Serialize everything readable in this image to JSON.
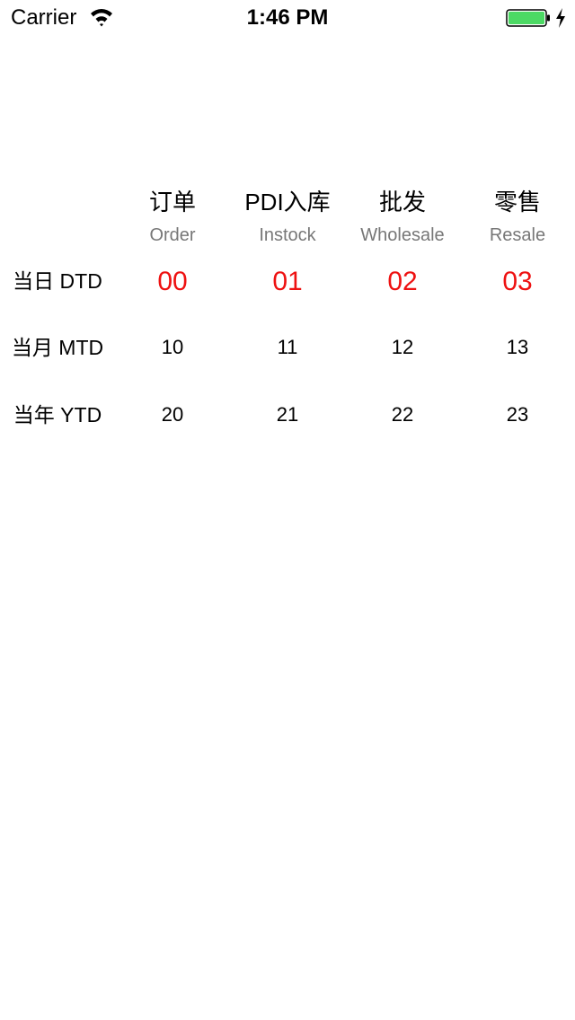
{
  "status_bar": {
    "carrier": "Carrier",
    "time": "1:46 PM",
    "battery_color": "#4cd964"
  },
  "table": {
    "columns": [
      {
        "cn": "订单",
        "en": "Order"
      },
      {
        "cn": "PDI入库",
        "en": "Instock"
      },
      {
        "cn": "批发",
        "en": "Wholesale"
      },
      {
        "cn": "零售",
        "en": "Resale"
      }
    ],
    "rows": [
      {
        "label": "当日 DTD",
        "values": [
          "00",
          "01",
          "02",
          "03"
        ]
      },
      {
        "label": "当月 MTD",
        "values": [
          "10",
          "11",
          "12",
          "13"
        ]
      },
      {
        "label": "当年 YTD",
        "values": [
          "20",
          "21",
          "22",
          "23"
        ]
      }
    ],
    "highlight_color": "#ee1111"
  }
}
